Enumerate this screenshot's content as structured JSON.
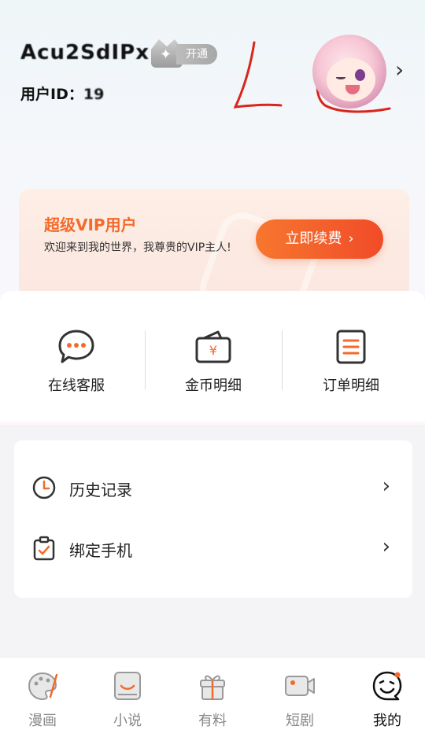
{
  "profile": {
    "username": "Acu2SdIPx",
    "vip_badge_label": "开通",
    "user_id_label": "用户ID：",
    "user_id_value": "19",
    "chevron": "›"
  },
  "vip_card": {
    "title": "超级VIP用户",
    "description": "欢迎来到我的世界，我尊贵的VIP主人!",
    "renew_label": "立即续费",
    "renew_arrow": "›"
  },
  "services": [
    {
      "label": "在线客服",
      "icon": "chat-bubble-icon"
    },
    {
      "label": "金币明细",
      "icon": "wallet-icon"
    },
    {
      "label": "订单明细",
      "icon": "order-list-icon"
    }
  ],
  "menu": [
    {
      "label": "历史记录",
      "icon": "clock-icon"
    },
    {
      "label": "绑定手机",
      "icon": "clipboard-check-icon"
    }
  ],
  "tabs": [
    {
      "label": "漫画",
      "icon": "palette-icon",
      "active": false
    },
    {
      "label": "小说",
      "icon": "book-icon",
      "active": false
    },
    {
      "label": "有料",
      "icon": "gift-icon",
      "active": false
    },
    {
      "label": "短剧",
      "icon": "video-icon",
      "active": false
    },
    {
      "label": "我的",
      "icon": "profile-face-icon",
      "active": true
    }
  ],
  "colors": {
    "accent": "#F36A2A",
    "button_gradient_start": "#F7772E",
    "button_gradient_end": "#F14B28",
    "scribble": "#D9261C"
  }
}
